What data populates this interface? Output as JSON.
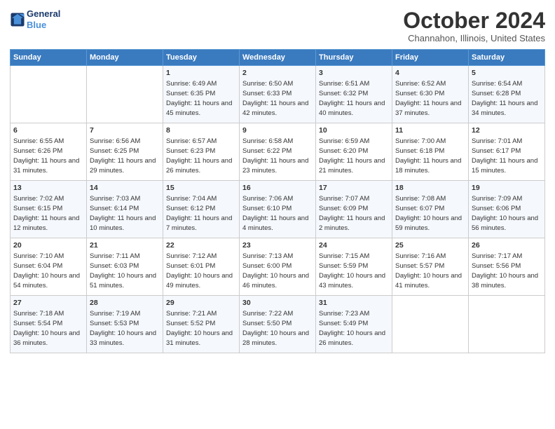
{
  "header": {
    "logo_line1": "General",
    "logo_line2": "Blue",
    "month_title": "October 2024",
    "location": "Channahon, Illinois, United States"
  },
  "weekdays": [
    "Sunday",
    "Monday",
    "Tuesday",
    "Wednesday",
    "Thursday",
    "Friday",
    "Saturday"
  ],
  "weeks": [
    [
      {
        "day": "",
        "sunrise": "",
        "sunset": "",
        "daylight": ""
      },
      {
        "day": "",
        "sunrise": "",
        "sunset": "",
        "daylight": ""
      },
      {
        "day": "1",
        "sunrise": "Sunrise: 6:49 AM",
        "sunset": "Sunset: 6:35 PM",
        "daylight": "Daylight: 11 hours and 45 minutes."
      },
      {
        "day": "2",
        "sunrise": "Sunrise: 6:50 AM",
        "sunset": "Sunset: 6:33 PM",
        "daylight": "Daylight: 11 hours and 42 minutes."
      },
      {
        "day": "3",
        "sunrise": "Sunrise: 6:51 AM",
        "sunset": "Sunset: 6:32 PM",
        "daylight": "Daylight: 11 hours and 40 minutes."
      },
      {
        "day": "4",
        "sunrise": "Sunrise: 6:52 AM",
        "sunset": "Sunset: 6:30 PM",
        "daylight": "Daylight: 11 hours and 37 minutes."
      },
      {
        "day": "5",
        "sunrise": "Sunrise: 6:54 AM",
        "sunset": "Sunset: 6:28 PM",
        "daylight": "Daylight: 11 hours and 34 minutes."
      }
    ],
    [
      {
        "day": "6",
        "sunrise": "Sunrise: 6:55 AM",
        "sunset": "Sunset: 6:26 PM",
        "daylight": "Daylight: 11 hours and 31 minutes."
      },
      {
        "day": "7",
        "sunrise": "Sunrise: 6:56 AM",
        "sunset": "Sunset: 6:25 PM",
        "daylight": "Daylight: 11 hours and 29 minutes."
      },
      {
        "day": "8",
        "sunrise": "Sunrise: 6:57 AM",
        "sunset": "Sunset: 6:23 PM",
        "daylight": "Daylight: 11 hours and 26 minutes."
      },
      {
        "day": "9",
        "sunrise": "Sunrise: 6:58 AM",
        "sunset": "Sunset: 6:22 PM",
        "daylight": "Daylight: 11 hours and 23 minutes."
      },
      {
        "day": "10",
        "sunrise": "Sunrise: 6:59 AM",
        "sunset": "Sunset: 6:20 PM",
        "daylight": "Daylight: 11 hours and 21 minutes."
      },
      {
        "day": "11",
        "sunrise": "Sunrise: 7:00 AM",
        "sunset": "Sunset: 6:18 PM",
        "daylight": "Daylight: 11 hours and 18 minutes."
      },
      {
        "day": "12",
        "sunrise": "Sunrise: 7:01 AM",
        "sunset": "Sunset: 6:17 PM",
        "daylight": "Daylight: 11 hours and 15 minutes."
      }
    ],
    [
      {
        "day": "13",
        "sunrise": "Sunrise: 7:02 AM",
        "sunset": "Sunset: 6:15 PM",
        "daylight": "Daylight: 11 hours and 12 minutes."
      },
      {
        "day": "14",
        "sunrise": "Sunrise: 7:03 AM",
        "sunset": "Sunset: 6:14 PM",
        "daylight": "Daylight: 11 hours and 10 minutes."
      },
      {
        "day": "15",
        "sunrise": "Sunrise: 7:04 AM",
        "sunset": "Sunset: 6:12 PM",
        "daylight": "Daylight: 11 hours and 7 minutes."
      },
      {
        "day": "16",
        "sunrise": "Sunrise: 7:06 AM",
        "sunset": "Sunset: 6:10 PM",
        "daylight": "Daylight: 11 hours and 4 minutes."
      },
      {
        "day": "17",
        "sunrise": "Sunrise: 7:07 AM",
        "sunset": "Sunset: 6:09 PM",
        "daylight": "Daylight: 11 hours and 2 minutes."
      },
      {
        "day": "18",
        "sunrise": "Sunrise: 7:08 AM",
        "sunset": "Sunset: 6:07 PM",
        "daylight": "Daylight: 10 hours and 59 minutes."
      },
      {
        "day": "19",
        "sunrise": "Sunrise: 7:09 AM",
        "sunset": "Sunset: 6:06 PM",
        "daylight": "Daylight: 10 hours and 56 minutes."
      }
    ],
    [
      {
        "day": "20",
        "sunrise": "Sunrise: 7:10 AM",
        "sunset": "Sunset: 6:04 PM",
        "daylight": "Daylight: 10 hours and 54 minutes."
      },
      {
        "day": "21",
        "sunrise": "Sunrise: 7:11 AM",
        "sunset": "Sunset: 6:03 PM",
        "daylight": "Daylight: 10 hours and 51 minutes."
      },
      {
        "day": "22",
        "sunrise": "Sunrise: 7:12 AM",
        "sunset": "Sunset: 6:01 PM",
        "daylight": "Daylight: 10 hours and 49 minutes."
      },
      {
        "day": "23",
        "sunrise": "Sunrise: 7:13 AM",
        "sunset": "Sunset: 6:00 PM",
        "daylight": "Daylight: 10 hours and 46 minutes."
      },
      {
        "day": "24",
        "sunrise": "Sunrise: 7:15 AM",
        "sunset": "Sunset: 5:59 PM",
        "daylight": "Daylight: 10 hours and 43 minutes."
      },
      {
        "day": "25",
        "sunrise": "Sunrise: 7:16 AM",
        "sunset": "Sunset: 5:57 PM",
        "daylight": "Daylight: 10 hours and 41 minutes."
      },
      {
        "day": "26",
        "sunrise": "Sunrise: 7:17 AM",
        "sunset": "Sunset: 5:56 PM",
        "daylight": "Daylight: 10 hours and 38 minutes."
      }
    ],
    [
      {
        "day": "27",
        "sunrise": "Sunrise: 7:18 AM",
        "sunset": "Sunset: 5:54 PM",
        "daylight": "Daylight: 10 hours and 36 minutes."
      },
      {
        "day": "28",
        "sunrise": "Sunrise: 7:19 AM",
        "sunset": "Sunset: 5:53 PM",
        "daylight": "Daylight: 10 hours and 33 minutes."
      },
      {
        "day": "29",
        "sunrise": "Sunrise: 7:21 AM",
        "sunset": "Sunset: 5:52 PM",
        "daylight": "Daylight: 10 hours and 31 minutes."
      },
      {
        "day": "30",
        "sunrise": "Sunrise: 7:22 AM",
        "sunset": "Sunset: 5:50 PM",
        "daylight": "Daylight: 10 hours and 28 minutes."
      },
      {
        "day": "31",
        "sunrise": "Sunrise: 7:23 AM",
        "sunset": "Sunset: 5:49 PM",
        "daylight": "Daylight: 10 hours and 26 minutes."
      },
      {
        "day": "",
        "sunrise": "",
        "sunset": "",
        "daylight": ""
      },
      {
        "day": "",
        "sunrise": "",
        "sunset": "",
        "daylight": ""
      }
    ]
  ]
}
